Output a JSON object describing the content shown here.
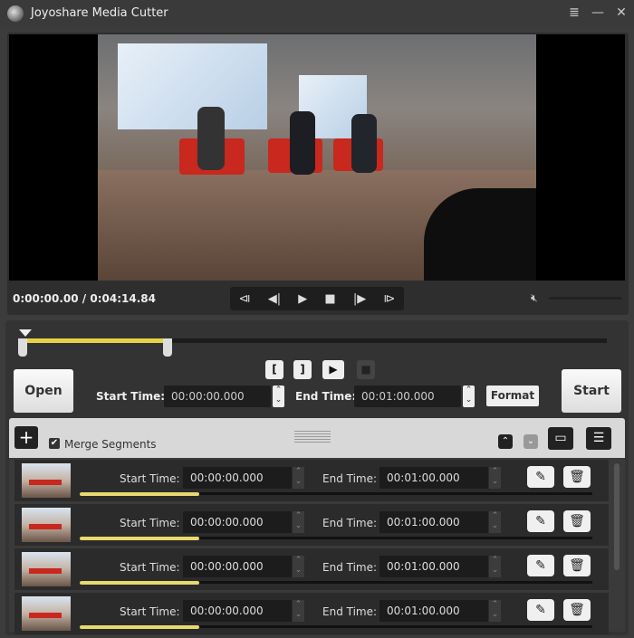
{
  "window": {
    "title": "Joyoshare Media Cutter",
    "menu_icon": "≣",
    "minimize_icon": "—",
    "close_icon": "✕"
  },
  "player": {
    "time": "0:00:00.00 / 0:04:14.84",
    "controls": [
      "⧏",
      "◀|",
      "▶",
      "■",
      "|▶",
      "⧐"
    ],
    "mute_icon": "🔇︎"
  },
  "timeline": {
    "selection_fraction": [
      0,
      0.23
    ]
  },
  "edit": {
    "mark_in": "[",
    "mark_out": "]",
    "preview": "▶",
    "stop": "■",
    "open": "Open",
    "start_label": "Start Time:",
    "start_value": "00:00:00.000",
    "end_label": "End Time:",
    "end_value": "00:01:00.000",
    "format": "Format",
    "start": "Start"
  },
  "segments": {
    "add": "+",
    "merge_label": "Merge Segments",
    "merge_checked": true,
    "rows": [
      {
        "start_label": "Start Time:",
        "start": "00:00:00.000",
        "end_label": "End Time:",
        "end": "00:01:00.000"
      },
      {
        "start_label": "Start Time:",
        "start": "00:00:00.000",
        "end_label": "End Time:",
        "end": "00:01:00.000"
      },
      {
        "start_label": "Start Time:",
        "start": "00:00:00.000",
        "end_label": "End Time:",
        "end": "00:01:00.000"
      },
      {
        "start_label": "Start Time:",
        "start": "00:00:00.000",
        "end_label": "End Time:",
        "end": "00:01:00.000"
      }
    ]
  },
  "colors": {
    "accent": "#e6d345",
    "background": "#333333"
  }
}
